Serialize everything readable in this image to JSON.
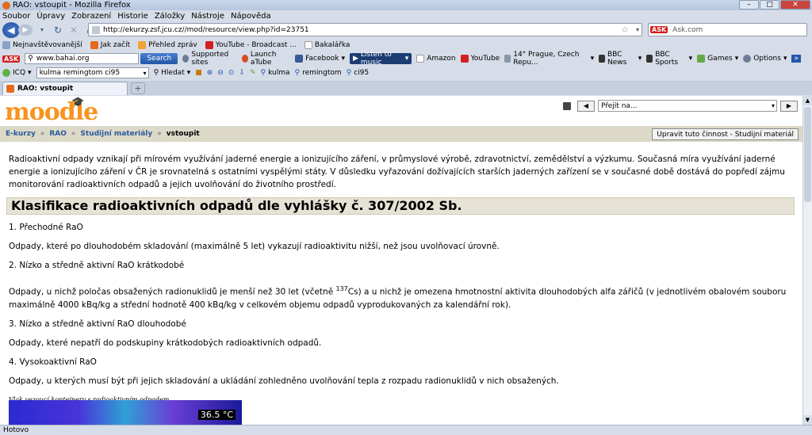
{
  "window": {
    "title": "RAO: vstoupit - Mozilla Firefox",
    "minimize": "–",
    "maximize": "□",
    "close": "✕"
  },
  "menu": [
    "Soubor",
    "Úpravy",
    "Zobrazení",
    "Historie",
    "Záložky",
    "Nástroje",
    "Nápověda"
  ],
  "nav": {
    "url": "http://ekurzy.zsf.jcu.cz//mod/resource/view.php?id=23751",
    "ask_placeholder": "Ask.com",
    "ask_logo": "ASK"
  },
  "bookmarks": [
    "Nejnavštěvovanější",
    "Jak začít",
    "Přehled zpráv",
    "YouTube - Broadcast ...",
    "Bakalářka"
  ],
  "toolbar2": {
    "ask_logo": "ASK",
    "search_value": "www.bahai.org",
    "search_button": "Search",
    "items": [
      "Supported sites",
      "Launch aTube",
      "Facebook",
      "Listen to music",
      "Amazon",
      "YouTube",
      "14° Prague, Czech Repu...",
      "BBC News",
      "BBC Sports",
      "Games",
      "Options"
    ]
  },
  "toolbar3": {
    "icq": "ICQ",
    "search_value": "kulma remingtom ci95",
    "hledat": "Hledat",
    "words": [
      "kulma",
      "remingtom",
      "ci95"
    ]
  },
  "tabs": [
    {
      "label": "RAO: vstoupit"
    }
  ],
  "moodle": {
    "logo": "moodle",
    "jump_placeholder": "Přejít na...",
    "breadcrumb": [
      "E-kurzy",
      "RAO",
      "Studijní materiály",
      "vstoupit"
    ],
    "edit_button": "Upravit tuto činnost - Studijní materiál"
  },
  "content": {
    "intro": "Radioaktivní odpady vznikají při mírovém využívání jaderné energie a ionizujícího záření, v průmyslové výrobě, zdravotnictví, zemědělství a výzkumu. Současná míra využívání jaderné energie a ionizujícího záření v ČR je srovnatelná s ostatními vyspělými státy. V důsledku vyřazování dožívajících starších jaderných zařízení se v současné době dostává do popředí zájmu monitorování radioaktivních odpadů a jejich uvolňování do životního prostředí.",
    "heading": "Klasifikace radioaktivních odpadů dle vyhlášky č. 307/2002 Sb.",
    "s1_title": "1. Přechodné RaO",
    "s1_text": "Odpady, které po dlouhodobém skladování (maximálně 5 let) vykazují radioaktivitu nižší, než jsou uvolňovací úrovně.",
    "s2_title": "2. Nízko a středně aktivní RaO krátkodobé",
    "s2_text_a": "Odpady, u nichž poločas obsažených radionuklidů je menší než 30 let (včetně ",
    "s2_sup": "137",
    "s2_text_b": "Cs) a u nichž je omezena hmotnostní aktivita dlouhodobých alfa zářičů (v jednotlivém obalovém souboru maximálně 4000 kBq/kg a střední hodnotě 400 kBq/kg v celkovém objemu odpadů vyprodukovaných za kalendářní rok).",
    "s3_title": "3. Nízko a středně aktivní RaO dlouhodobé",
    "s3_text": "Odpady, které nepatří do podskupiny krátkodobých radioaktivních odpadů.",
    "s4_title": "4. Vysokoaktivní RaO",
    "s4_text": "Odpady, u kterých musí být při jejich skladování a ukládání zohledněno uvolňování tepla z rozpadu radionuklidů v nich obsažených.",
    "caption": "Vlak vezoucí kontejnery s radioaktivním odpadem",
    "thermo_label": "36.5 °C"
  },
  "status": "Hotovo",
  "colors": {
    "moodle_orange": "#f7931e",
    "crumb_blue": "#2b5a9e",
    "nav_bg": "#ddd9c8"
  }
}
